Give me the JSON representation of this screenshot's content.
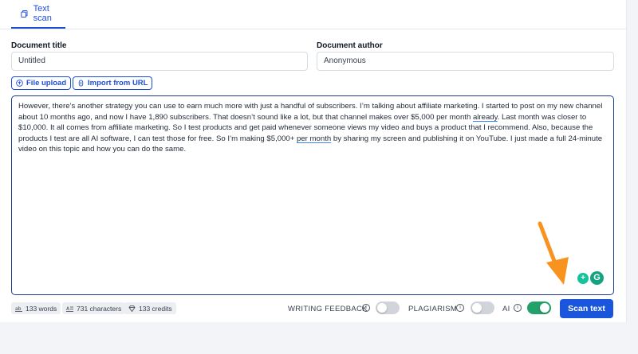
{
  "tabs": [
    {
      "label": "Text scan",
      "icon": "documents-icon"
    }
  ],
  "fields": {
    "title": {
      "label": "Document title",
      "value": "Untitled"
    },
    "author": {
      "label": "Document author",
      "value": "Anonymous"
    }
  },
  "actions": {
    "file_upload": "File upload",
    "import_url": "Import from URL"
  },
  "editor": {
    "text_before_1": "However, there’s another strategy you can use to earn much more with just a handful of subscribers. I’m talking about affiliate marketing. I started to post on my new channel about 10 months ago, and now I have 1,890 subscribers. That doesn’t sound like a lot, but that channel makes over $5,000 per month ",
    "underline_1": "already",
    "text_between": ". Last month was closer to $10,000. It all comes from affiliate marketing. So I test products and get paid whenever someone views my video and buys a product that I recommend. Also, because the products I test are all AI software, I can test those for free. So I’m making $5,000+ ",
    "underline_2": "per month",
    "text_after": " by sharing my screen and publishing it on YouTube. I just made a full 24-minute video on this topic and how you can do the same."
  },
  "grammarly": {
    "badge_a": "+",
    "badge_b": "G"
  },
  "stats": {
    "words": "133 words",
    "characters": "731 characters",
    "credits": "133 credits"
  },
  "options": {
    "writing_feedback": {
      "label": "WRITING FEEDBACK",
      "info": "i",
      "enabled": false
    },
    "plagiarism": {
      "label": "PLAGIARISM",
      "info": "i",
      "enabled": false
    },
    "ai": {
      "label": "AI",
      "info": "i",
      "enabled": true
    }
  },
  "scan_button": "Scan text",
  "colors": {
    "accent": "#1a56db",
    "toggle_on": "#22a16a",
    "annotation_arrow": "#f7931e"
  }
}
